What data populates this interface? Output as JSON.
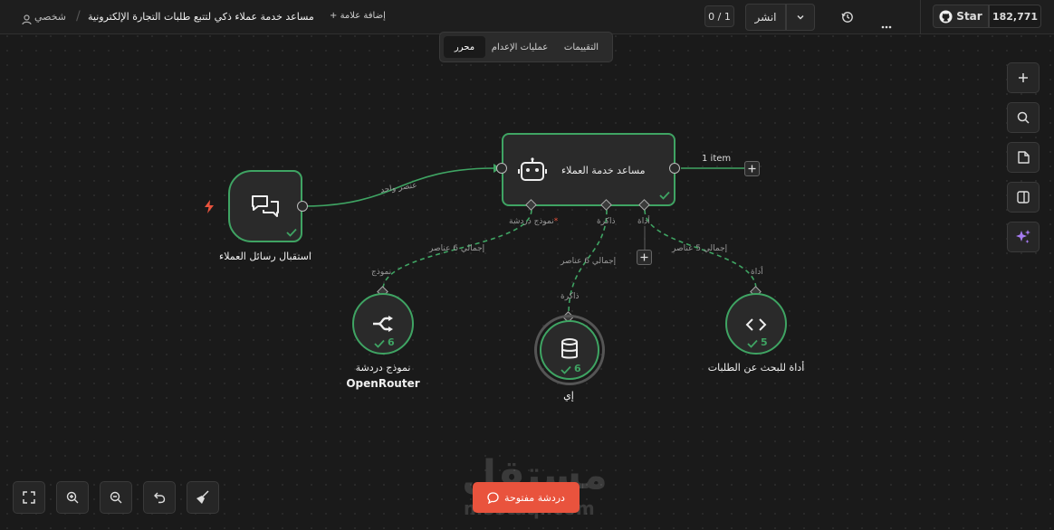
{
  "header": {
    "user_label": "شخصي",
    "workflow_title": "مساعد خدمة عملاء ذكي لتتبع طلبات التجارة الإلكترونية",
    "add_tag_label": "+ إضافة علامة",
    "version_counter": "0 / 1",
    "publish_label": "انشر",
    "github_label": "Star",
    "github_stars": "182,771"
  },
  "tabs": [
    "التقييمات",
    "عمليات الإعدام",
    "محرر"
  ],
  "nodes": {
    "trigger": {
      "label": "استقبال رسائل العملاء"
    },
    "agent": {
      "label": "مساعد خدمة العملاء",
      "output": "1 item"
    },
    "chat_model": {
      "label": "نموذج دردشة",
      "label2": "OpenRouter",
      "count": "6"
    },
    "memory": {
      "label": "إي",
      "count": "6"
    },
    "tool": {
      "label": "أداة للبحث عن الطلبات",
      "count": "5"
    }
  },
  "connections": {
    "trigger_to_agent": "عنصر واحد",
    "chat_model_total": "إجمالي 6 عناصر",
    "memory_total": "إجمالي 6 عناصر",
    "tool_total": "إجمالي 5 عناصر"
  },
  "ports": {
    "agent_chat_model": "نموذج دردشة",
    "agent_memory": "ذاكرة",
    "agent_tool": "أداة",
    "chat_model_in": "نموذج",
    "memory_in": "ذاكرة",
    "tool_in": "أداة"
  },
  "chat_button": "دردشة مفتوحة",
  "watermark": {
    "main": "مستقل",
    "sub": "mostaql.com"
  },
  "colors": {
    "success": "#3fa463",
    "accent": "#e9533d",
    "ai": "#a77cf2"
  }
}
